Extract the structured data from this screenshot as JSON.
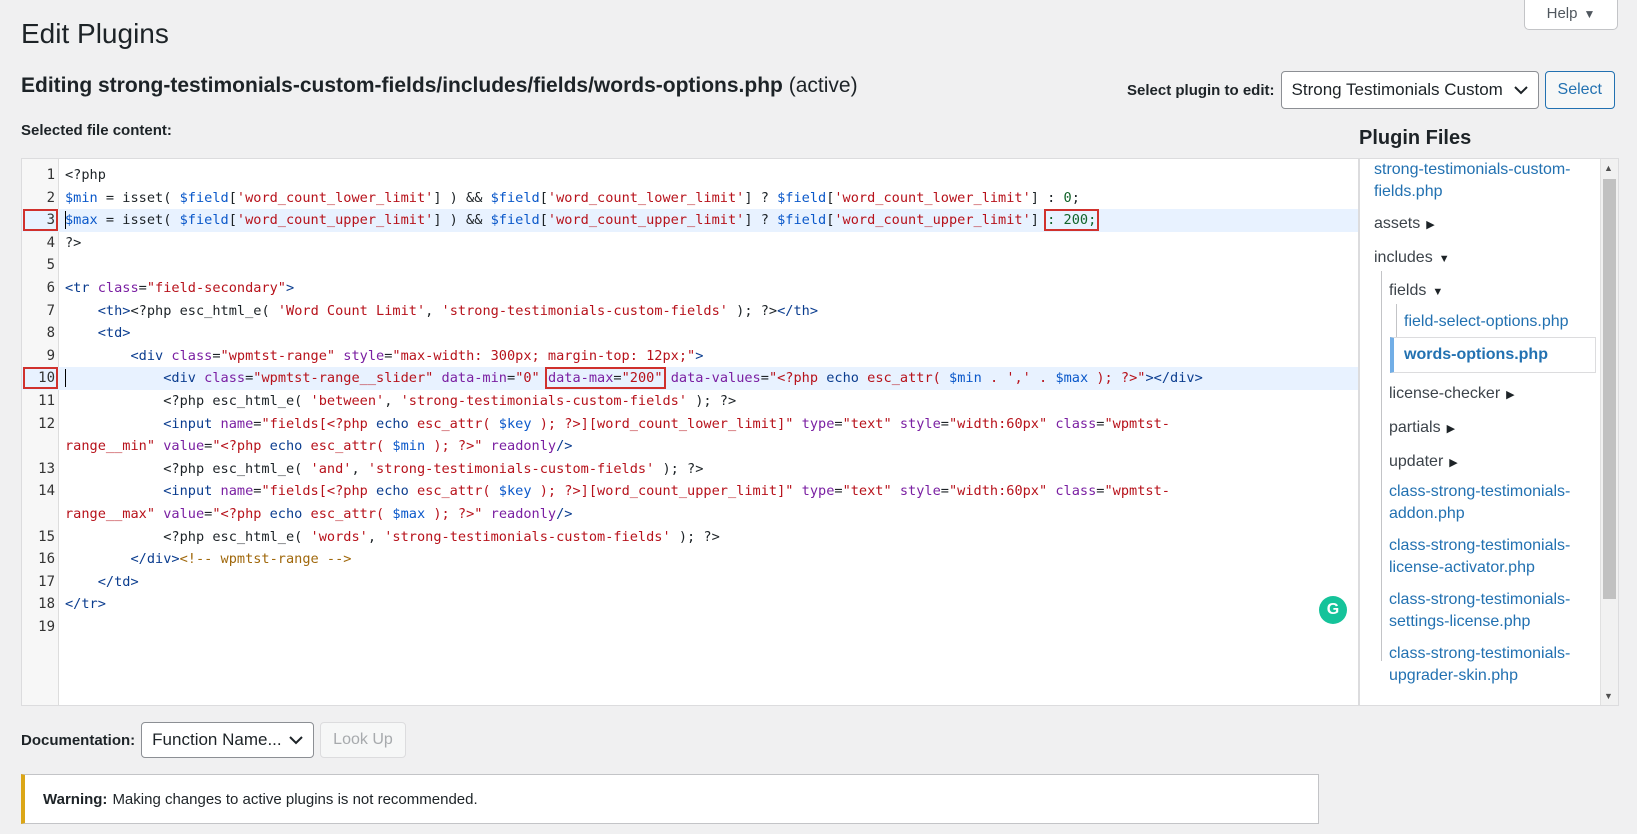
{
  "page_title": "Edit Plugins",
  "help": {
    "label": "Help",
    "arrow": "▼"
  },
  "editing": {
    "prefix": "Editing",
    "file": "strong-testimonials-custom-fields/includes/fields/words-options.php",
    "status": "(active)"
  },
  "select_plugin": {
    "label": "Select plugin to edit:",
    "value": "Strong Testimonials Custom",
    "button": "Select"
  },
  "selected_file_label": "Selected file content:",
  "plugin_files": {
    "heading": "Plugin Files",
    "items": [
      {
        "name": "strong-testimonials-custom-",
        "cont": "fields.php",
        "type": "file"
      },
      {
        "name": "assets",
        "type": "folder",
        "arrow": "▶"
      },
      {
        "name": "includes",
        "type": "folder",
        "arrow": "▼"
      },
      {
        "name": "fields",
        "type": "folder",
        "arrow": "▼"
      },
      {
        "name": "field-select-options.php",
        "type": "file"
      },
      {
        "name": "words-options.php",
        "type": "file"
      },
      {
        "name": "license-checker",
        "type": "folder",
        "arrow": "▶"
      },
      {
        "name": "partials",
        "type": "folder",
        "arrow": "▶"
      },
      {
        "name": "updater",
        "type": "folder",
        "arrow": "▶"
      },
      {
        "name": "class-strong-testimonials-",
        "cont": "addon.php",
        "type": "file"
      },
      {
        "name": "class-strong-testimonials-",
        "cont": "license-activator.php",
        "type": "file"
      },
      {
        "name": "class-strong-testimonials-",
        "cont": "settings-license.php",
        "type": "file"
      },
      {
        "name": "class-strong-testimonials-",
        "cont": "upgrader-skin.php",
        "type": "file"
      }
    ]
  },
  "code": {
    "line_numbers": [
      "1",
      "2",
      "3",
      "4",
      "5",
      "6",
      "7",
      "8",
      "9",
      "10",
      "11",
      "12",
      "",
      "13",
      "14",
      "",
      "15",
      "16",
      "17",
      "18",
      "19"
    ],
    "l1": "<?php",
    "l2": {
      "v1": "$min",
      "o1": " = isset( ",
      "v2": "$field",
      "o2": "[",
      "s1": "'word_count_lower_limit'",
      "o3": "] ) && ",
      "v3": "$field",
      "o4": "[",
      "s2": "'word_count_lower_limit'",
      "o5": "] ? ",
      "v4": "$field",
      "o6": "[",
      "s3": "'word_count_lower_limit'",
      "o7": "] : ",
      "n1": "0",
      "o8": ";"
    },
    "l3": {
      "v1": "$max",
      "o1": " = isset( ",
      "v2": "$field",
      "o2": "[",
      "s1": "'word_count_upper_limit'",
      "o3": "] ) && ",
      "v3": "$field",
      "o4": "[",
      "s2": "'word_count_upper_limit'",
      "o5": "] ? ",
      "v4": "$field",
      "o6": "[",
      "s3": "'word_count_upper_limit'",
      "o7": "] ",
      "hl": ": 200;"
    },
    "l4": "?>",
    "l6": {
      "t1": "<tr",
      "a1": " class",
      "o1": "=",
      "s1": "\"field-secondary\"",
      "t2": ">"
    },
    "l7": {
      "ind": "    ",
      "t1": "<th>",
      "o1": "<?php esc_html_e( ",
      "s1": "'Word Count Limit'",
      "o2": ", ",
      "s2": "'strong-testimonials-custom-fields'",
      "o3": " ); ?>",
      "t2": "</th>"
    },
    "l8": {
      "ind": "    ",
      "t1": "<td>"
    },
    "l9": {
      "ind": "        ",
      "t1": "<div",
      "a1": " class",
      "o1": "=",
      "s1": "\"wpmtst-range\"",
      "a2": " style",
      "o2": "=",
      "s2": "\"max-width: 300px; margin-top: 12px;\"",
      "t2": ">"
    },
    "l10": {
      "ind": "            ",
      "t1": "<div",
      "a1": " class",
      "o1": "=",
      "s1": "\"wpmtst-range__slider\"",
      "a2": " data-min",
      "o2": "=",
      "s2": "\"0\"",
      "sp": " ",
      "hl_a": "data-max",
      "hl_o": "=",
      "hl_s": "\"200\"",
      "a3": " data-values",
      "o3": "=",
      "s3a": "\"<?php ",
      "k1": "echo",
      "s3b": " esc_attr( ",
      "v1": "$min",
      "s3c": " . ',' . ",
      "v2": "$max",
      "s3d": " ); ?>\"",
      "t2": "></div>"
    },
    "l11": {
      "ind": "            ",
      "o1": "<?php esc_html_e( ",
      "s1": "'between'",
      "o2": ", ",
      "s2": "'strong-testimonials-custom-fields'",
      "o3": " ); ?>"
    },
    "l12a": {
      "ind": "            ",
      "t1": "<input",
      "a1": " name",
      "o1": "=",
      "s1a": "\"fields[<?php ",
      "k1": "echo",
      "s1b": " esc_attr( ",
      "v1": "$key",
      "s1c": " ); ?>][word_count_lower_limit]\"",
      "a2": " type",
      "o2": "=",
      "s2": "\"text\"",
      "a3": " style",
      "o3": "=",
      "s3": "\"width:60px\"",
      "a4": " class",
      "o4": "=",
      "s4": "\"wpmtst-"
    },
    "l12b": {
      "s4": "range__min\"",
      "a5": " value",
      "o5": "=",
      "s5a": "\"<?php ",
      "k1": "echo",
      "s5b": " esc_attr( ",
      "v1": "$min",
      "s5c": " ); ?>\"",
      "a6": " readonly",
      "t2": "/>"
    },
    "l13": {
      "ind": "            ",
      "o1": "<?php esc_html_e( ",
      "s1": "'and'",
      "o2": ", ",
      "s2": "'strong-testimonials-custom-fields'",
      "o3": " ); ?>"
    },
    "l14a": {
      "ind": "            ",
      "t1": "<input",
      "a1": " name",
      "o1": "=",
      "s1a": "\"fields[<?php ",
      "k1": "echo",
      "s1b": " esc_attr( ",
      "v1": "$key",
      "s1c": " ); ?>][word_count_upper_limit]\"",
      "a2": " type",
      "o2": "=",
      "s2": "\"text\"",
      "a3": " style",
      "o3": "=",
      "s3": "\"width:60px\"",
      "a4": " class",
      "o4": "=",
      "s4": "\"wpmtst-"
    },
    "l14b": {
      "s4": "range__max\"",
      "a5": " value",
      "o5": "=",
      "s5a": "\"<?php ",
      "k1": "echo",
      "s5b": " esc_attr( ",
      "v1": "$max",
      "s5c": " ); ?>\"",
      "a6": " readonly",
      "t2": "/>"
    },
    "l15": {
      "ind": "            ",
      "o1": "<?php esc_html_e( ",
      "s1": "'words'",
      "o2": ", ",
      "s2": "'strong-testimonials-custom-fields'",
      "o3": " ); ?>"
    },
    "l16": {
      "ind": "        ",
      "t1": "</div>",
      "c1": "<!-- wpmtst-range -->"
    },
    "l17": {
      "ind": "    ",
      "t1": "</td>"
    },
    "l18": {
      "t1": "</tr>"
    }
  },
  "documentation": {
    "label": "Documentation:",
    "value": "Function Name...",
    "button": "Look Up"
  },
  "notice": {
    "strong": "Warning:",
    "text": "Making changes to active plugins is not recommended."
  },
  "colors": {
    "accent": "#2271b1",
    "warning": "#dba617",
    "highlight_box": "#d0312d",
    "active_line": "#e8f2ff"
  }
}
